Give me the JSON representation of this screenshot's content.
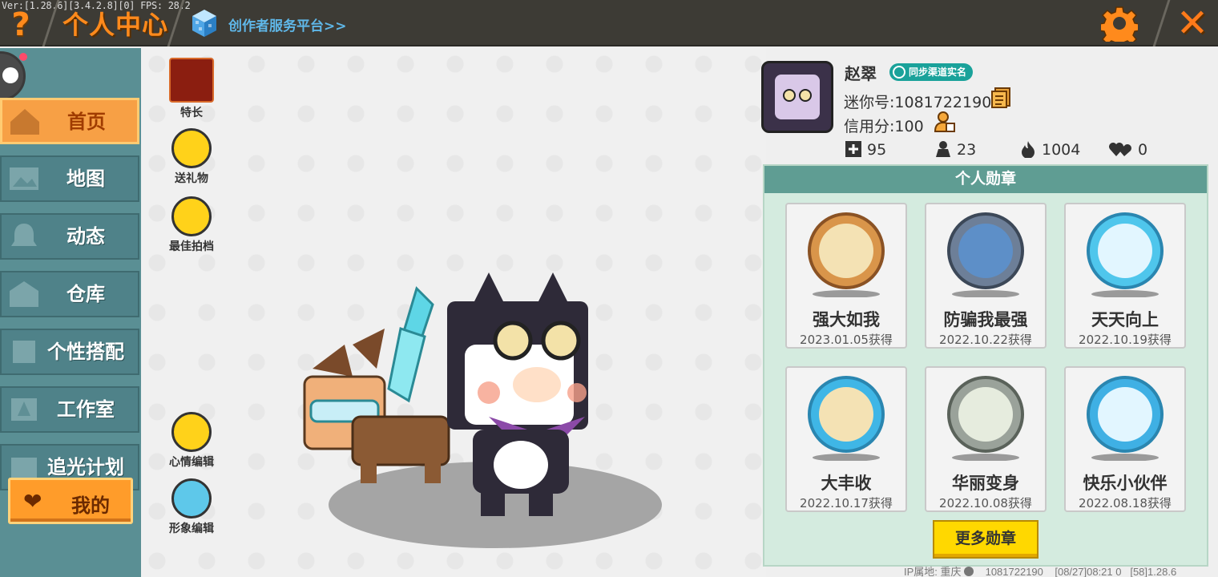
{
  "debug": {
    "version_text": "Ver:[1.28.6][3.4.2.8][0] FPS: 28.2"
  },
  "header": {
    "help_glyph": "?",
    "title": "个人中心",
    "creator_link": "创作者服务平台>>",
    "close_glyph": "✕"
  },
  "sidebar": {
    "items": [
      {
        "label": "首页",
        "icon": "house-icon",
        "active": true
      },
      {
        "label": "地图",
        "icon": "map-icon",
        "active": false
      },
      {
        "label": "动态",
        "icon": "bell-icon",
        "active": false
      },
      {
        "label": "仓库",
        "icon": "warehouse-icon",
        "active": false
      },
      {
        "label": "个性搭配",
        "icon": "outfit-icon",
        "active": false
      },
      {
        "label": "工作室",
        "icon": "studio-icon",
        "active": false
      },
      {
        "label": "追光计划",
        "icon": "spotlight-icon",
        "active": false
      }
    ],
    "me_button": {
      "label": "我的",
      "icon": "heart-icon"
    }
  },
  "actions": {
    "specialty": "特长",
    "send_gift": "送礼物",
    "best_partner": "最佳拍档",
    "mood_edit": "心情编辑",
    "appearance_edit": "形象编辑"
  },
  "profile": {
    "name": "赵翠",
    "verify_badge": "同步渠道实名",
    "mini_id": "迷你号:1081722190",
    "credit": "信用分:100",
    "stats": [
      {
        "icon": "plus-box-icon",
        "value": "95"
      },
      {
        "icon": "fans-icon",
        "value": "23"
      },
      {
        "icon": "flame-icon",
        "value": "1004"
      },
      {
        "icon": "hearts-icon",
        "value": "0"
      }
    ]
  },
  "medals": {
    "title": "个人勋章",
    "items": [
      {
        "name": "强大如我",
        "date": "2023.01.05获得",
        "color": "#d9954a"
      },
      {
        "name": "防骗我最强",
        "date": "2022.10.22获得",
        "color": "#6d7f98"
      },
      {
        "name": "天天向上",
        "date": "2022.10.19获得",
        "color": "#4fc6ec"
      },
      {
        "name": "大丰收",
        "date": "2022.10.17获得",
        "color": "#3fb6e6"
      },
      {
        "name": "华丽变身",
        "date": "2022.10.08获得",
        "color": "#9aa29a"
      },
      {
        "name": "快乐小伙伴",
        "date": "2022.08.18获得",
        "color": "#3fb0e4"
      }
    ],
    "more_button": "更多勋章"
  },
  "footer": {
    "ip_location": "IP属地: 重庆",
    "info_icon": "info-icon",
    "uid": "1081722190",
    "timestamp": "[08/27]08:21 0",
    "build": "[58]1.28.6"
  },
  "colors": {
    "accent_orange": "#ff8a1c",
    "sidebar_teal": "#4f8289",
    "medal_header": "#5f9d93",
    "medal_panel": "#d4ebdf",
    "button_yellow": "#ffd800"
  }
}
